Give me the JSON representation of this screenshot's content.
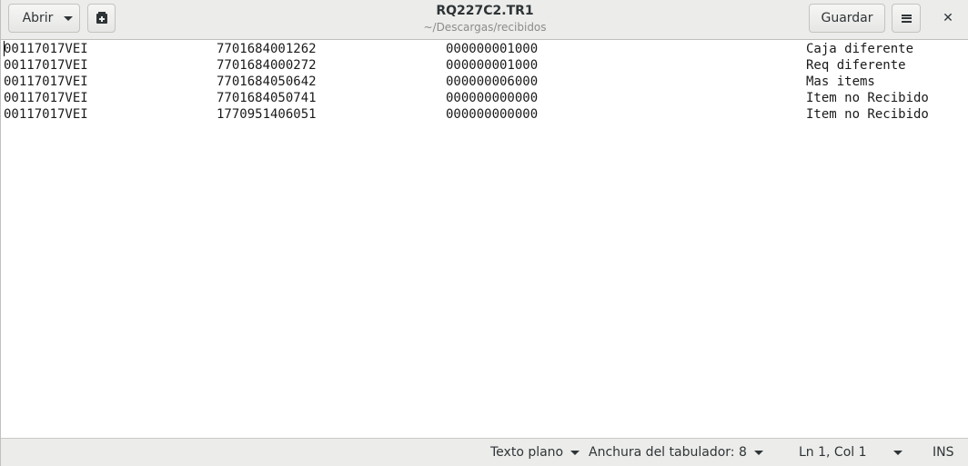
{
  "header": {
    "open_label": "Abrir",
    "new_icon": "new-document-icon",
    "title": "RQ227C2.TR1",
    "subtitle": "~/Descargas/recibidos",
    "save_label": "Guardar",
    "menu_icon": "hamburger-icon",
    "close_glyph": "✕"
  },
  "document": {
    "lines": [
      [
        "00117017VEI",
        "7701684001262",
        "000000001000",
        "Caja diferente"
      ],
      [
        "00117017VEI",
        "7701684000272",
        "000000001000",
        "Req diferente"
      ],
      [
        "00117017VEI",
        "7701684050642",
        "000000006000",
        "Mas items"
      ],
      [
        "00117017VEI",
        "7701684050741",
        "000000000000",
        "Item no Recibido"
      ],
      [
        "00117017VEI",
        "1770951406051",
        "000000000000",
        "Item no Recibido"
      ]
    ]
  },
  "statusbar": {
    "language": "Texto plano",
    "tab_width": "Anchura del tabulador: 8",
    "position": "Ln 1, Col 1",
    "mode": "INS"
  }
}
